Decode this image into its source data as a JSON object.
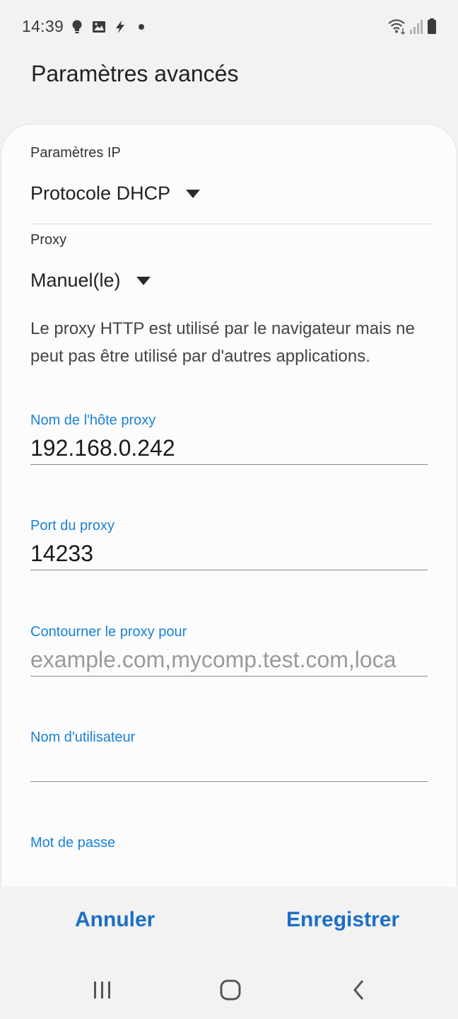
{
  "status_bar": {
    "time": "14:39",
    "left_icons": [
      "bulb-icon",
      "image-icon",
      "flash-icon",
      "dot-icon"
    ],
    "right_icons": [
      "wifi-icon",
      "signal-icon",
      "battery-icon"
    ]
  },
  "header": {
    "title": "Paramètres avancés"
  },
  "ip_settings": {
    "label": "Paramètres IP",
    "value": "Protocole DHCP"
  },
  "proxy": {
    "label": "Proxy",
    "value": "Manuel(le)",
    "help": "Le proxy HTTP est utilisé par le navigateur mais ne peut pas être utilisé par d'autres applications."
  },
  "fields": {
    "host": {
      "label": "Nom de l'hôte proxy",
      "value": "192.168.0.242",
      "placeholder": ""
    },
    "port": {
      "label": "Port du proxy",
      "value": "14233",
      "placeholder": ""
    },
    "bypass": {
      "label": "Contourner le proxy pour",
      "value": "",
      "placeholder": "example.com,mycomp.test.com,loca"
    },
    "username": {
      "label": "Nom d'utilisateur",
      "value": "",
      "placeholder": ""
    },
    "password": {
      "label": "Mot de passe",
      "value": "",
      "placeholder": ""
    }
  },
  "actions": {
    "cancel": "Annuler",
    "save": "Enregistrer"
  },
  "colors": {
    "accent": "#1a6fc6",
    "field_label": "#1a82d6",
    "background": "#f2f2f2",
    "card": "#fcfcfc"
  }
}
